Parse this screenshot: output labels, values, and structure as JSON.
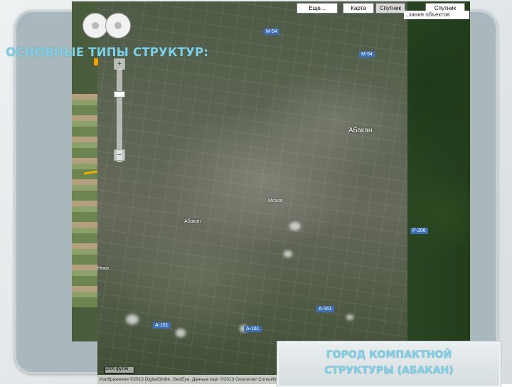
{
  "slide": {
    "heading": "ОСНОВНЫЕ ТИПЫ СТРУКТУР:",
    "caption_line1": "ГОРОД КОМПАКТНОЙ",
    "caption_line2": "СТРУКТУРЫ (АБАКАН)"
  },
  "map": {
    "type_buttons": [
      "Еще...",
      "Карта",
      "Спутник",
      "Спутник"
    ],
    "note": "...зания объектов",
    "city_label": "Абакан",
    "station_label": "Абакан",
    "district_label": "Мохов",
    "other_label": "Ники",
    "roads": [
      "М-54",
      "М-54",
      "Р-208",
      "А-161",
      "А-161",
      "А-161"
    ],
    "zoom_in": "+",
    "zoom_out": "−",
    "scale": "2000 футов",
    "copyright": "Изображения ©2013 DigitalGlobe, GeoEye, Данные карт ©2013 Geocenter Consulting"
  },
  "colors": {
    "heading": "#7fd0e6",
    "frame": "#aab8bd",
    "road_shield": "#3d6fb0",
    "marker": "#f2a200"
  }
}
